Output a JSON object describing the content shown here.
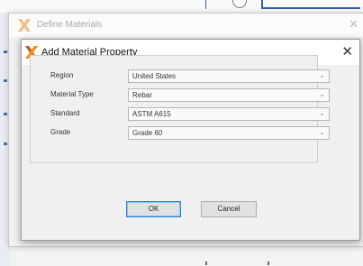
{
  "outer_window": {
    "title": "Define Materials",
    "close_symbol": "✕"
  },
  "dialog": {
    "title": "Add Material Property",
    "close_symbol": "✕"
  },
  "fields": [
    {
      "label": "Region",
      "value": "United States"
    },
    {
      "label": "Material Type",
      "value": "Rebar"
    },
    {
      "label": "Standard",
      "value": "ASTM A615"
    },
    {
      "label": "Grade",
      "value": "Grade 60"
    }
  ],
  "dropdown_arrow": "⌄",
  "buttons": {
    "ok": "OK",
    "cancel": "Cancel"
  },
  "icons": {
    "app_logo": "x-logo-icon",
    "close": "close-icon",
    "dropdown": "chevron-down-icon"
  },
  "colors": {
    "logo_orange": "#f08a1c",
    "logo_dark": "#c0541a",
    "ok_focus_border": "#2f7fd8",
    "background_accent": "#3a5da8"
  }
}
